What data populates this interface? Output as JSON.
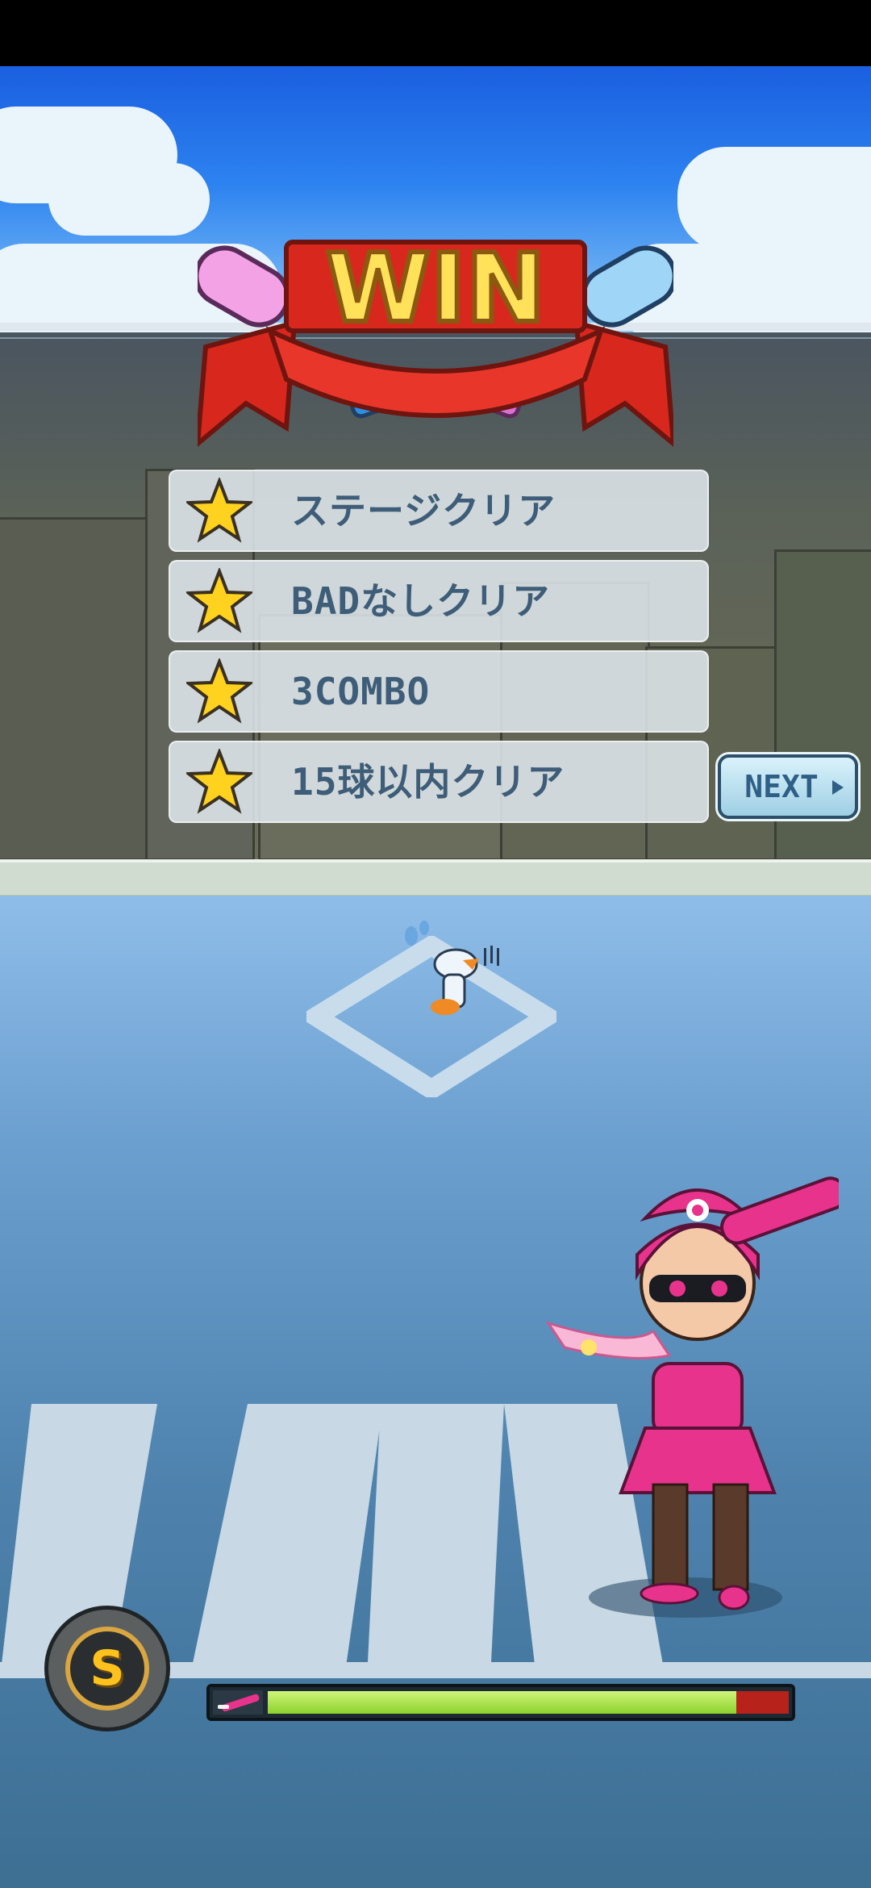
{
  "result_title": "WIN",
  "missions": [
    {
      "label": "ステージクリア",
      "achieved": true
    },
    {
      "label": "BADなしクリア",
      "achieved": true
    },
    {
      "label": "3COMBO",
      "achieved": true
    },
    {
      "label": "15球以内クリア",
      "achieved": true
    }
  ],
  "next_button": {
    "label": "NEXT"
  },
  "rank_badge": {
    "letter": "S"
  },
  "power_gauge": {
    "level": 0.9
  },
  "colors": {
    "accent_pink": "#e8338d",
    "gauge_green": "#9be03a",
    "gauge_red": "#b7221b",
    "star_yellow": "#ffd21f"
  }
}
